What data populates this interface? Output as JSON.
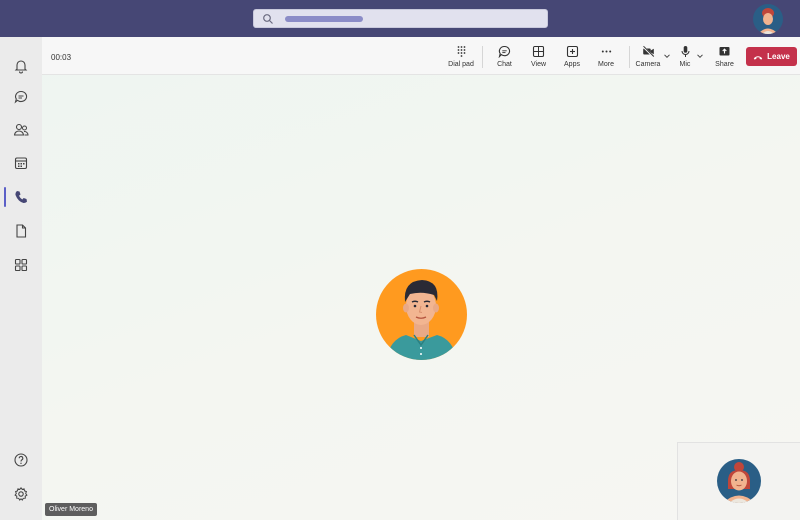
{
  "search": {
    "placeholder": "",
    "icon": "search-icon"
  },
  "rail": {
    "items": [
      {
        "icon": "bell-icon",
        "name": "Activity"
      },
      {
        "icon": "chat-icon",
        "name": "Chat"
      },
      {
        "icon": "people-icon",
        "name": "Teams"
      },
      {
        "icon": "calendar-icon",
        "name": "Calendar"
      },
      {
        "icon": "phone-icon",
        "name": "Calls",
        "active": true
      },
      {
        "icon": "file-icon",
        "name": "Files"
      },
      {
        "icon": "apps-icon",
        "name": "Apps"
      }
    ],
    "bottom": [
      {
        "icon": "help-icon",
        "name": "Help"
      },
      {
        "icon": "settings-icon",
        "name": "Settings"
      }
    ]
  },
  "call": {
    "timer": "00:03",
    "controls": {
      "dialpad": "Dial pad",
      "chat": "Chat",
      "view": "View",
      "apps": "Apps",
      "more": "More",
      "camera": "Camera",
      "mic": "Mic",
      "share": "Share",
      "leave": "Leave"
    },
    "remote_participant": {
      "name": "Oliver Moreno"
    }
  },
  "colors": {
    "topbar": "#464775",
    "leave": "#c4314b",
    "accent": "#5b5fc7",
    "remote_avatar_bg": "#ff9a1f",
    "self_avatar_bg": "#2a5e86"
  }
}
